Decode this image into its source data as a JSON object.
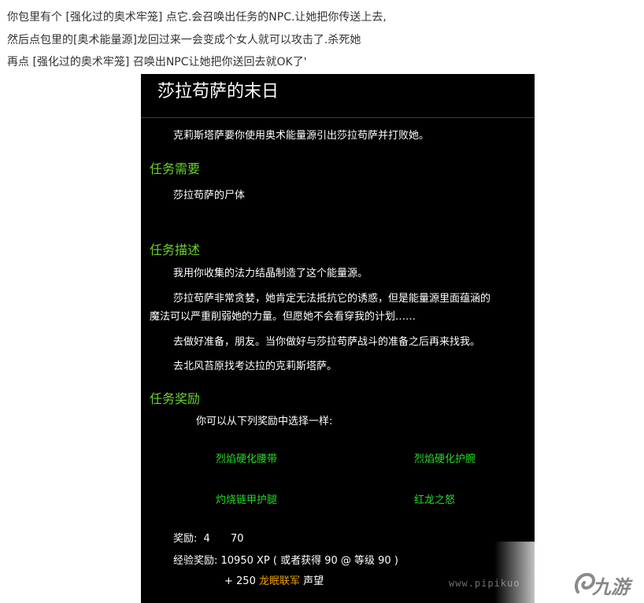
{
  "intro": {
    "line1": "你包里有个 [强化过的奥术牢笼] 点它.会召唤出任务的NPC.让她把你传送上去,",
    "line2": "然后点包里的[奥术能量源]龙回过来一会变成个女人就可以攻击了.杀死她",
    "line3": "再点 [强化过的奥术牢笼] 召唤出NPC让她把你送回去就OK了'"
  },
  "quest": {
    "title": "莎拉苟萨的末日",
    "summary": "克莉斯塔萨要你使用奥术能量源引出莎拉苟萨并打败她。",
    "requirements_heading": "任务需要",
    "requirement_item": "莎拉苟萨的尸体",
    "description_heading": "任务描述",
    "description": [
      "我用你收集的法力结晶制造了这个能量源。",
      "莎拉苟萨非常贪婪，她肯定无法抵抗它的诱惑，但是能量源里面蕴涵的",
      "魔法可以严重削弱她的力量。但愿她不会看穿我的计划……",
      "去做好准备，朋友。当你做好与莎拉苟萨战斗的准备之后再来找我。",
      "去北风苔原找考达拉的克莉斯塔萨。"
    ],
    "rewards_heading": "任务奖励",
    "choose_text": "你可以从下列奖励中选择一样:",
    "reward_items": [
      "烈焰硬化腰带",
      "烈焰硬化护腕",
      "灼烧链甲护腿",
      "红龙之怒"
    ],
    "money_label": "奖励:",
    "money_gold": "4",
    "money_silver": "70",
    "xp_line": "经验奖励: 10950 XP ( 或者获得  90     @ 等级 90 )",
    "rep_prefix": "+ 250",
    "rep_faction": "龙眠联军",
    "rep_suffix": "声望"
  },
  "watermark": {
    "site": "www.pipikuo",
    "logo": "九游"
  },
  "colors": {
    "panel_bg": "#000000",
    "heading_green": "#6bd22b",
    "reward_green": "#22dd22",
    "faction_orange": "#f0a000"
  }
}
